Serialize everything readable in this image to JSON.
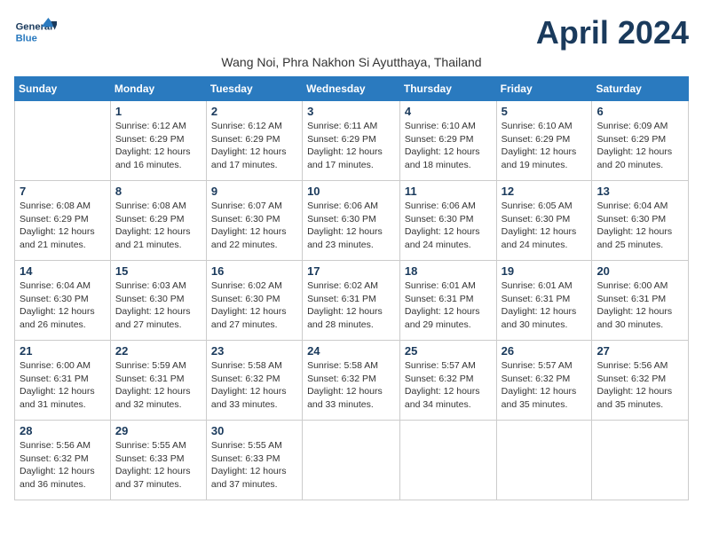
{
  "logo": {
    "general": "General",
    "blue": "Blue"
  },
  "title": "April 2024",
  "subtitle": "Wang Noi, Phra Nakhon Si Ayutthaya, Thailand",
  "days_of_week": [
    "Sunday",
    "Monday",
    "Tuesday",
    "Wednesday",
    "Thursday",
    "Friday",
    "Saturday"
  ],
  "weeks": [
    [
      {
        "day": "",
        "info": ""
      },
      {
        "day": "1",
        "info": "Sunrise: 6:12 AM\nSunset: 6:29 PM\nDaylight: 12 hours\nand 16 minutes."
      },
      {
        "day": "2",
        "info": "Sunrise: 6:12 AM\nSunset: 6:29 PM\nDaylight: 12 hours\nand 17 minutes."
      },
      {
        "day": "3",
        "info": "Sunrise: 6:11 AM\nSunset: 6:29 PM\nDaylight: 12 hours\nand 17 minutes."
      },
      {
        "day": "4",
        "info": "Sunrise: 6:10 AM\nSunset: 6:29 PM\nDaylight: 12 hours\nand 18 minutes."
      },
      {
        "day": "5",
        "info": "Sunrise: 6:10 AM\nSunset: 6:29 PM\nDaylight: 12 hours\nand 19 minutes."
      },
      {
        "day": "6",
        "info": "Sunrise: 6:09 AM\nSunset: 6:29 PM\nDaylight: 12 hours\nand 20 minutes."
      }
    ],
    [
      {
        "day": "7",
        "info": "Sunrise: 6:08 AM\nSunset: 6:29 PM\nDaylight: 12 hours\nand 21 minutes."
      },
      {
        "day": "8",
        "info": "Sunrise: 6:08 AM\nSunset: 6:29 PM\nDaylight: 12 hours\nand 21 minutes."
      },
      {
        "day": "9",
        "info": "Sunrise: 6:07 AM\nSunset: 6:30 PM\nDaylight: 12 hours\nand 22 minutes."
      },
      {
        "day": "10",
        "info": "Sunrise: 6:06 AM\nSunset: 6:30 PM\nDaylight: 12 hours\nand 23 minutes."
      },
      {
        "day": "11",
        "info": "Sunrise: 6:06 AM\nSunset: 6:30 PM\nDaylight: 12 hours\nand 24 minutes."
      },
      {
        "day": "12",
        "info": "Sunrise: 6:05 AM\nSunset: 6:30 PM\nDaylight: 12 hours\nand 24 minutes."
      },
      {
        "day": "13",
        "info": "Sunrise: 6:04 AM\nSunset: 6:30 PM\nDaylight: 12 hours\nand 25 minutes."
      }
    ],
    [
      {
        "day": "14",
        "info": "Sunrise: 6:04 AM\nSunset: 6:30 PM\nDaylight: 12 hours\nand 26 minutes."
      },
      {
        "day": "15",
        "info": "Sunrise: 6:03 AM\nSunset: 6:30 PM\nDaylight: 12 hours\nand 27 minutes."
      },
      {
        "day": "16",
        "info": "Sunrise: 6:02 AM\nSunset: 6:30 PM\nDaylight: 12 hours\nand 27 minutes."
      },
      {
        "day": "17",
        "info": "Sunrise: 6:02 AM\nSunset: 6:31 PM\nDaylight: 12 hours\nand 28 minutes."
      },
      {
        "day": "18",
        "info": "Sunrise: 6:01 AM\nSunset: 6:31 PM\nDaylight: 12 hours\nand 29 minutes."
      },
      {
        "day": "19",
        "info": "Sunrise: 6:01 AM\nSunset: 6:31 PM\nDaylight: 12 hours\nand 30 minutes."
      },
      {
        "day": "20",
        "info": "Sunrise: 6:00 AM\nSunset: 6:31 PM\nDaylight: 12 hours\nand 30 minutes."
      }
    ],
    [
      {
        "day": "21",
        "info": "Sunrise: 6:00 AM\nSunset: 6:31 PM\nDaylight: 12 hours\nand 31 minutes."
      },
      {
        "day": "22",
        "info": "Sunrise: 5:59 AM\nSunset: 6:31 PM\nDaylight: 12 hours\nand 32 minutes."
      },
      {
        "day": "23",
        "info": "Sunrise: 5:58 AM\nSunset: 6:32 PM\nDaylight: 12 hours\nand 33 minutes."
      },
      {
        "day": "24",
        "info": "Sunrise: 5:58 AM\nSunset: 6:32 PM\nDaylight: 12 hours\nand 33 minutes."
      },
      {
        "day": "25",
        "info": "Sunrise: 5:57 AM\nSunset: 6:32 PM\nDaylight: 12 hours\nand 34 minutes."
      },
      {
        "day": "26",
        "info": "Sunrise: 5:57 AM\nSunset: 6:32 PM\nDaylight: 12 hours\nand 35 minutes."
      },
      {
        "day": "27",
        "info": "Sunrise: 5:56 AM\nSunset: 6:32 PM\nDaylight: 12 hours\nand 35 minutes."
      }
    ],
    [
      {
        "day": "28",
        "info": "Sunrise: 5:56 AM\nSunset: 6:32 PM\nDaylight: 12 hours\nand 36 minutes."
      },
      {
        "day": "29",
        "info": "Sunrise: 5:55 AM\nSunset: 6:33 PM\nDaylight: 12 hours\nand 37 minutes."
      },
      {
        "day": "30",
        "info": "Sunrise: 5:55 AM\nSunset: 6:33 PM\nDaylight: 12 hours\nand 37 minutes."
      },
      {
        "day": "",
        "info": ""
      },
      {
        "day": "",
        "info": ""
      },
      {
        "day": "",
        "info": ""
      },
      {
        "day": "",
        "info": ""
      }
    ]
  ]
}
